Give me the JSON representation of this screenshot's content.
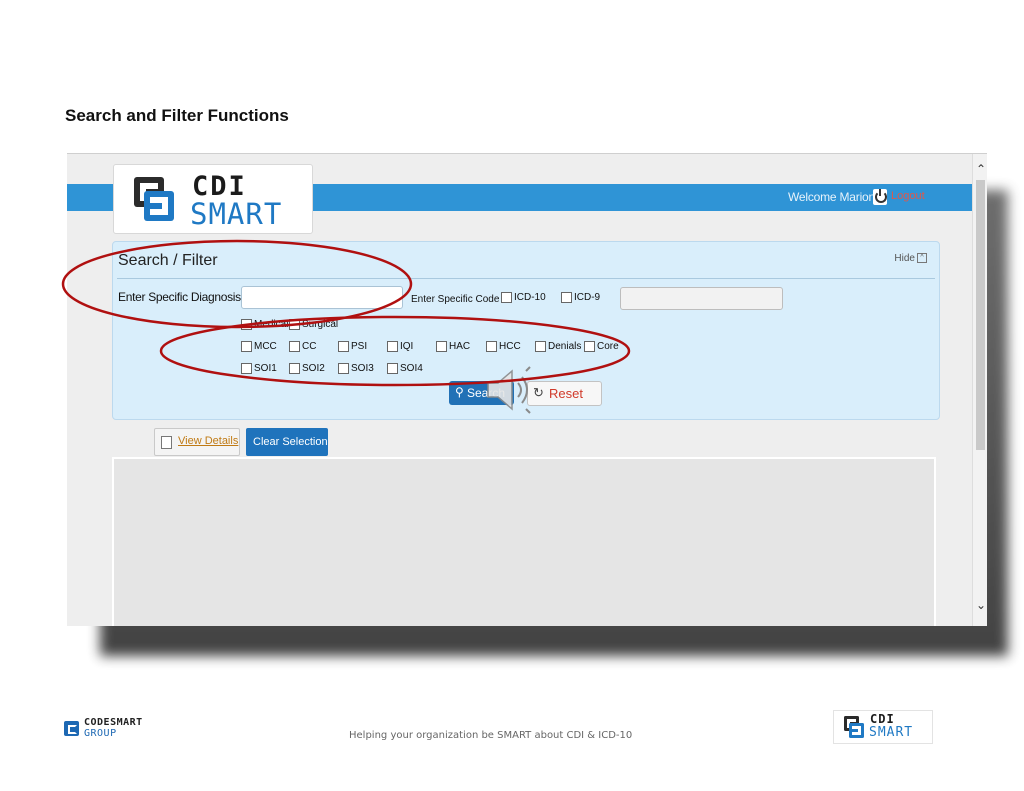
{
  "slide": {
    "title": "Search and Filter Functions",
    "footer": "Helping your organization be SMART about CDI & ICD-10"
  },
  "app": {
    "logo": {
      "line1": "CDI",
      "line2": "SMART"
    },
    "welcome": "Welcome Marion",
    "logout": "Logout",
    "icons": [
      "power-icon",
      "search-icon",
      "reset-icon",
      "document-icon",
      "speaker-icon"
    ]
  },
  "search_panel": {
    "title": "Search / Filter",
    "hide": "Hide",
    "diagnosis_label": "Enter Specific Diagnosis",
    "diagnosis_value": "",
    "code_label": "Enter Specific Code",
    "code_options": [
      "ICD-10",
      "ICD-9"
    ],
    "code_value": "",
    "row1": [
      "Medical",
      "Surgical"
    ],
    "row2": [
      "MCC",
      "CC",
      "PSI",
      "IQI",
      "HAC",
      "HCC",
      "Denials",
      "Core"
    ],
    "row3": [
      "SOI1",
      "SOI2",
      "SOI3",
      "SOI4"
    ],
    "search_button": "Search",
    "reset_button": "Reset"
  },
  "actions": {
    "view_details": "View Details",
    "clear_selection": "Clear Selection"
  },
  "footer_logos": {
    "left": {
      "line1": "CODESMART",
      "line2": "GROUP"
    },
    "right": {
      "line1": "CDI",
      "line2": "SMART"
    }
  },
  "colors": {
    "topbar": "#2f94d6",
    "panel_bg": "#d9eefb",
    "annotation": "#b01010",
    "brand_blue": "#1f79c4"
  }
}
